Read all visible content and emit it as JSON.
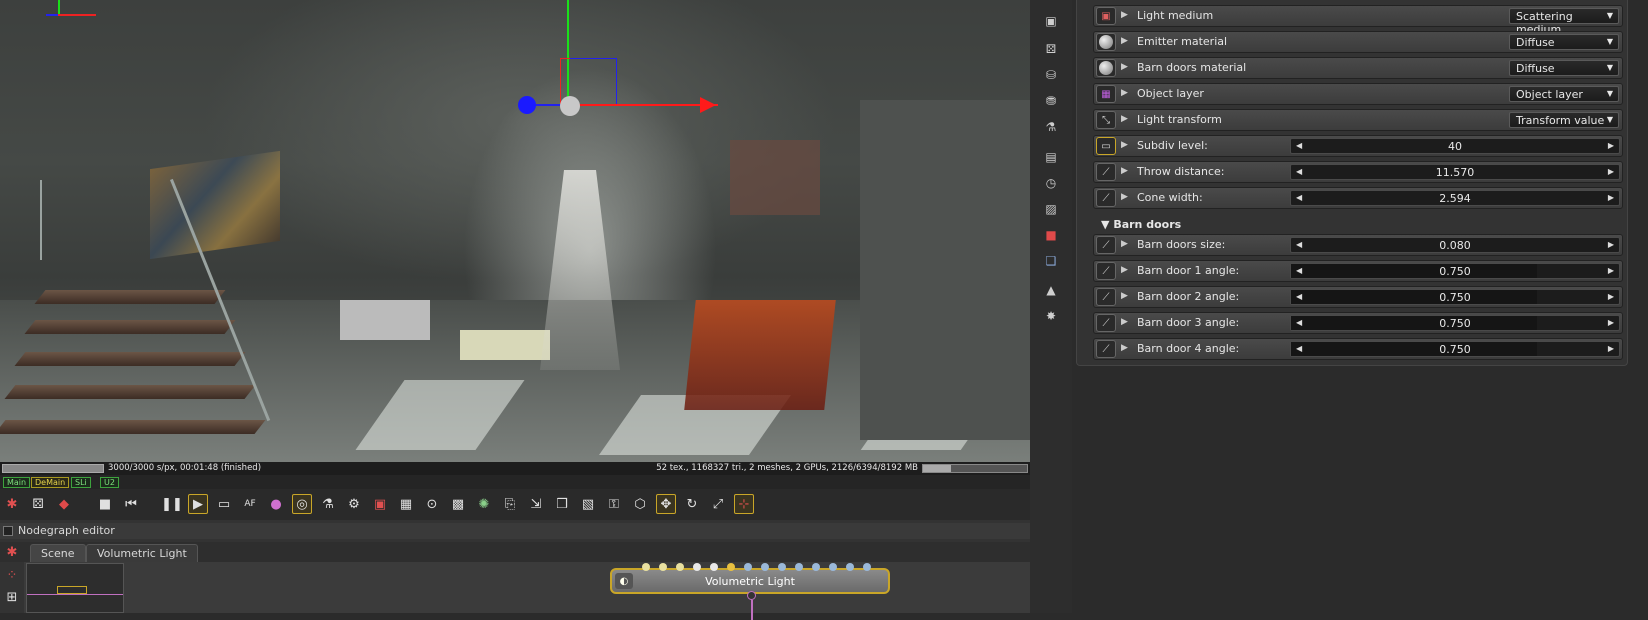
{
  "viewport": {
    "status": "3000/3000 s/px, 00:01:48 (finished)",
    "stats": "52 tex., 1168327 tri., 2 meshes, 2 GPUs, 2126/6394/8192 MB",
    "render_progress": 1.0,
    "memory_fraction": 0.26
  },
  "devices": [
    "Main",
    "DeMain",
    "SLi",
    "U2"
  ],
  "toolbar": {
    "icons": [
      "scene-icon",
      "camera-icon",
      "cube-icon",
      "stop-icon",
      "rewind-icon",
      "pause-icon",
      "play-icon",
      "render-icon",
      "af-icon",
      "color-icon",
      "lock-icon",
      "lights-icon",
      "material-icon",
      "region-icon",
      "inspect-icon",
      "checker-icon",
      "spray-icon",
      "copy-icon",
      "export-icon",
      "cube2-icon",
      "checker2-icon",
      "padlock-icon",
      "box-icon",
      "move-icon",
      "rotate-icon",
      "scale-icon",
      "axis-icon"
    ],
    "af_label": "AF",
    "play_active": true
  },
  "nodegraph": {
    "title": "Nodegraph editor",
    "tabs": [
      "Scene",
      "Volumetric Light"
    ],
    "node_label": "Volumetric Light"
  },
  "panel": {
    "rows": [
      {
        "label": "Light medium",
        "dropdown": "Scattering medium"
      },
      {
        "label": "Emitter material",
        "dropdown": "Diffuse"
      },
      {
        "label": "Barn doors material",
        "dropdown": "Diffuse"
      },
      {
        "label": "Object layer",
        "dropdown": "Object layer"
      },
      {
        "label": "Light transform",
        "dropdown": "Transform value"
      },
      {
        "label": "Subdiv level:",
        "value": "40",
        "fill": 0
      },
      {
        "label": "Throw distance:",
        "value": "11.570",
        "fill": 0
      },
      {
        "label": "Cone width:",
        "value": "2.594",
        "fill": 0
      }
    ],
    "section": "Barn doors",
    "barn_rows": [
      {
        "label": "Barn doors size:",
        "value": "0.080",
        "fill": 0
      },
      {
        "label": "Barn door 1 angle:",
        "value": "0.750",
        "fill": 0.75
      },
      {
        "label": "Barn door 2 angle:",
        "value": "0.750",
        "fill": 0.75
      },
      {
        "label": "Barn door 3 angle:",
        "value": "0.750",
        "fill": 0.75
      },
      {
        "label": "Barn door 4 angle:",
        "value": "0.750",
        "fill": 0.75
      }
    ]
  },
  "colors": {
    "accent": "#c9a628",
    "gizmo_x": "#ff1a1a",
    "gizmo_y": "#1aff1a",
    "gizmo_z": "#1a1aff"
  }
}
